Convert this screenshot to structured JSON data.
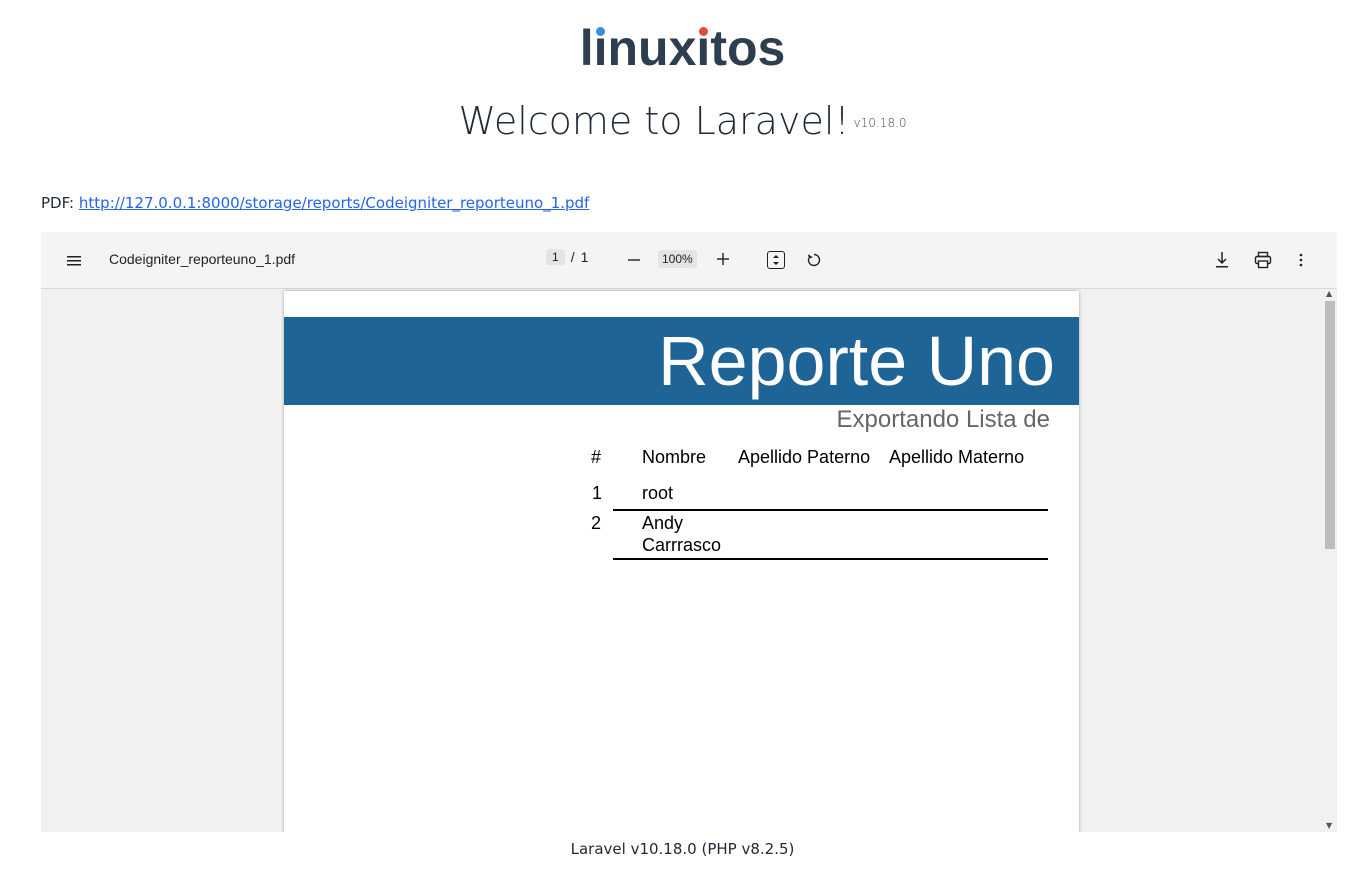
{
  "header": {
    "logo_parts": [
      "l",
      "i",
      "nux",
      "i",
      "tos"
    ],
    "welcome_title": "Welcome to Laravel!",
    "version_badge": "v10.18.0"
  },
  "pdf_link": {
    "label": "PDF:",
    "url": "http://127.0.0.1:8000/storage/reports/Codeigniter_reporteuno_1.pdf"
  },
  "viewer": {
    "file_name": "Codeigniter_reporteuno_1.pdf",
    "current_page": "1",
    "page_separator": "/",
    "total_pages": "1",
    "zoom": "100%",
    "icons": {
      "menu": "menu-icon",
      "zoom_out": "minus-icon",
      "zoom_in": "plus-icon",
      "fit": "fit-page-icon",
      "rotate": "rotate-icon",
      "download": "download-icon",
      "print": "print-icon",
      "more": "more-vert-icon"
    }
  },
  "document": {
    "title": "Reporte Uno",
    "subtitle": "Exportando Lista de",
    "banner_color": "#1f6496",
    "table": {
      "headers": [
        "#",
        "Nombre",
        "Apellido Paterno",
        "Apellido Materno"
      ],
      "rows": [
        {
          "num": "1",
          "nombre_line1": "root",
          "nombre_line2": ""
        },
        {
          "num": "2",
          "nombre_line1": "Andy",
          "nombre_line2": "Carrrasco"
        }
      ]
    }
  },
  "footer": {
    "text": "Laravel v10.18.0 (PHP v8.2.5)"
  }
}
